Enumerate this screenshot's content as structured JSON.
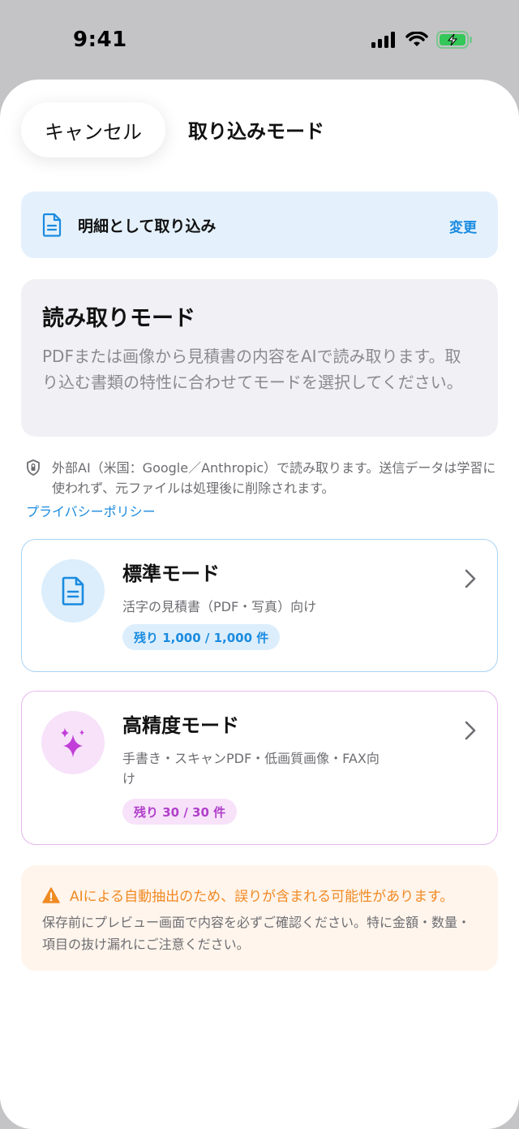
{
  "status_bar": {
    "time": "9:41"
  },
  "header": {
    "cancel_label": "キャンセル",
    "title": "取り込みモード"
  },
  "import_mode": {
    "label": "明細として取り込み",
    "change_label": "変更"
  },
  "info_card": {
    "title": "読み取りモード",
    "description": "PDFまたは画像から見積書の内容をAIで読み取ります。取り込む書類の特性に合わせてモードを選択してください。"
  },
  "privacy": {
    "text": "外部AI（米国：Google／Anthropic）で読み取ります。送信データは学習に使われず、元ファイルは処理後に削除されます。",
    "link_label": "プライバシーポリシー"
  },
  "modes": [
    {
      "name": "標準モード",
      "description": "活字の見積書（PDF・写真）向け",
      "badge": "残り 1,000 / 1,000 件",
      "icon": "document-icon",
      "accent": "#1a8be0"
    },
    {
      "name": "高精度モード",
      "description": "手書き・スキャンPDF・低画質画像・FAX向け",
      "badge": "残り 30 / 30 件",
      "icon": "sparkles-icon",
      "accent": "#b03fc9"
    }
  ],
  "warning": {
    "title": "AIによる自動抽出のため、誤りが含まれる可能性があります。",
    "text": "保存前にプレビュー画面で内容を必ずご確認ください。特に金額・数量・項目の抜け漏れにご注意ください。"
  },
  "colors": {
    "primary": "#1a8be0",
    "precise": "#b03fc9",
    "warning": "#f08a24"
  }
}
